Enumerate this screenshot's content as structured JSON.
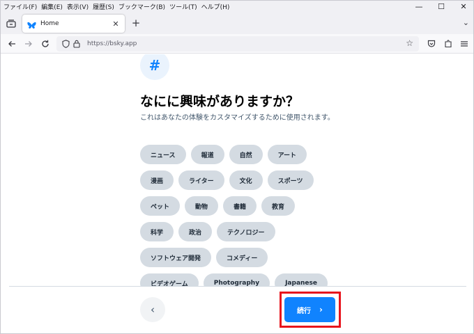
{
  "menubar": {
    "items": [
      "ファイル(F)",
      "編集(E)",
      "表示(V)",
      "履歴(S)",
      "ブックマーク(B)",
      "ツール(T)",
      "ヘルプ(H)"
    ]
  },
  "window_controls": {
    "minimize": "—",
    "maximize": "☐",
    "close": "✕"
  },
  "tab": {
    "title": "Home",
    "close": "✕",
    "new_tab": "+",
    "list_all": "⌄"
  },
  "navbar": {
    "url": "https://bsky.app"
  },
  "page": {
    "hash_symbol": "#",
    "heading": "なにに興味がありますか？",
    "subtext": "これはあなたの体験をカスタマイズするために使用されます。",
    "chip_rows": [
      [
        "ニュース",
        "報道",
        "自然",
        "アート"
      ],
      [
        "漫画",
        "ライター",
        "文化",
        "スポーツ"
      ],
      [
        "ペット",
        "動物",
        "書籍",
        "教育"
      ],
      [
        "科学",
        "政治",
        "テクノロジー"
      ],
      [
        "ソフトウェア開発",
        "コメディー"
      ],
      [
        "ビデオゲーム",
        "Photography",
        "Japanese"
      ]
    ],
    "back_symbol": "‹",
    "continue_label": "続行",
    "continue_symbol": "›"
  },
  "colors": {
    "accent": "#1083fe",
    "chip_bg": "#d4dbe2",
    "highlight": "#e8141c"
  }
}
